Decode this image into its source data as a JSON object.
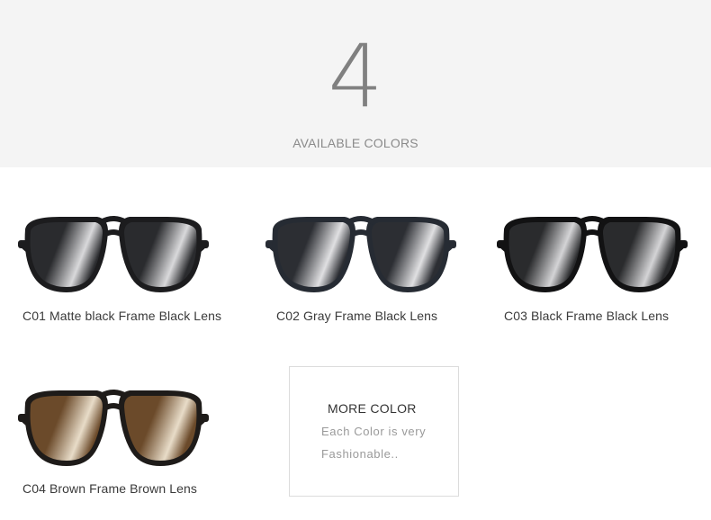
{
  "header": {
    "count": "4",
    "subtitle": "AVAILABLE COLORS"
  },
  "products": [
    {
      "code_label": "C01 Matte black Frame Black Lens",
      "frame_color": "#1c1c1e",
      "lens_color": "#2a2b2e",
      "lens_shine": "#d9d9db"
    },
    {
      "code_label": "C02 Gray Frame Black Lens",
      "frame_color": "#262b33",
      "lens_color": "#2c2e33",
      "lens_shine": "#e0e0e2"
    },
    {
      "code_label": "C03 Black Frame Black Lens",
      "frame_color": "#121213",
      "lens_color": "#2a2b2d",
      "lens_shine": "#d4d4d6"
    },
    {
      "code_label": "C04 Brown Frame Brown Lens",
      "frame_color": "#1e1b19",
      "lens_color": "#6b4a2a",
      "lens_shine": "#e8dcc8"
    }
  ],
  "more_box": {
    "title": "MORE COLOR",
    "line1": "Each Color is very",
    "line2": "Fashionable.."
  }
}
